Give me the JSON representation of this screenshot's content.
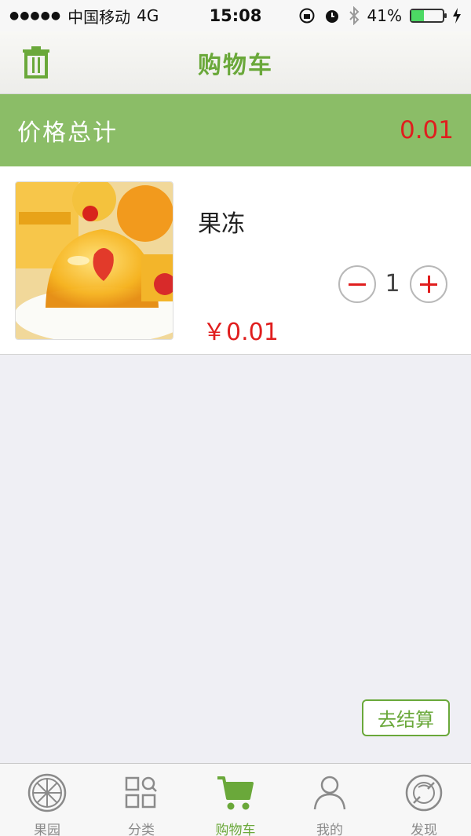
{
  "status_bar": {
    "signal": "●●●●●",
    "carrier": "中国移动",
    "network": "4G",
    "time": "15:08",
    "battery_text": "41%",
    "battery_level": 0.41
  },
  "nav": {
    "title": "购物车",
    "trash_icon": "trash-icon"
  },
  "summary": {
    "label": "价格总计",
    "value": "0.01"
  },
  "cart": {
    "items": [
      {
        "name": "果冻",
        "price": "￥0.01",
        "quantity": "1"
      }
    ]
  },
  "checkout_label": "去结算",
  "tabs": [
    {
      "label": "果园",
      "icon": "orange-slice-icon",
      "active": false
    },
    {
      "label": "分类",
      "icon": "grid-icon",
      "active": false
    },
    {
      "label": "购物车",
      "icon": "cart-icon",
      "active": true
    },
    {
      "label": "我的",
      "icon": "person-icon",
      "active": false
    },
    {
      "label": "发现",
      "icon": "compass-icon",
      "active": false
    }
  ],
  "colors": {
    "accent": "#6aa83a",
    "summary_bg": "#8bbd67",
    "price": "#e01e1e"
  }
}
